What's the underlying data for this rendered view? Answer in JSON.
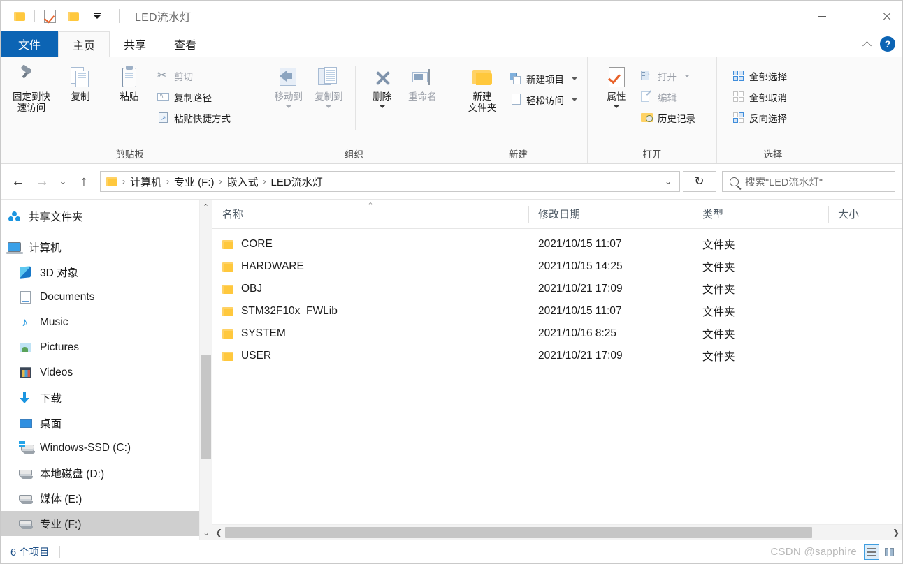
{
  "window": {
    "title": "LED流水灯",
    "quick_access": [
      "folder-icon",
      "properties-check-icon",
      "new-folder-icon",
      "customize-dropdown-icon"
    ],
    "controls": {
      "minimize": "minimize-icon",
      "maximize": "maximize-icon",
      "close": "close-icon"
    }
  },
  "ribbon": {
    "tabs": [
      {
        "label": "文件",
        "id": "file"
      },
      {
        "label": "主页",
        "id": "home"
      },
      {
        "label": "共享",
        "id": "share"
      },
      {
        "label": "查看",
        "id": "view"
      }
    ],
    "collapse_icon": "chevron-up-icon",
    "help_label": "?",
    "groups": [
      {
        "label": "剪贴板",
        "big": [
          {
            "label": "固定到快速访问",
            "line1": "固定到快",
            "line2": "速访问",
            "icon": "pin-icon"
          },
          {
            "label": "复制",
            "icon": "copy-icon"
          },
          {
            "label": "粘贴",
            "icon": "paste-icon"
          }
        ],
        "small": [
          {
            "label": "剪切",
            "icon": "scissors-icon"
          },
          {
            "label": "复制路径",
            "icon": "copy-path-icon"
          },
          {
            "label": "粘贴快捷方式",
            "icon": "paste-shortcut-icon"
          }
        ]
      },
      {
        "label": "组织",
        "big": [
          {
            "label": "移动到",
            "icon": "move-to-icon",
            "has_caret": true
          },
          {
            "label": "复制到",
            "icon": "copy-to-icon",
            "has_caret": true
          },
          {
            "label": "删除",
            "icon": "delete-icon",
            "has_caret": true
          },
          {
            "label": "重命名",
            "icon": "rename-icon"
          }
        ]
      },
      {
        "label": "新建",
        "big": [
          {
            "label": "新建文件夹",
            "line1": "新建",
            "line2": "文件夹",
            "icon": "new-folder-icon"
          }
        ],
        "small": [
          {
            "label": "新建项目",
            "icon": "new-item-icon",
            "has_caret": true
          },
          {
            "label": "轻松访问",
            "icon": "easy-access-icon",
            "has_caret": true
          }
        ]
      },
      {
        "label": "打开",
        "big": [
          {
            "label": "属性",
            "icon": "properties-icon",
            "has_caret": true
          }
        ],
        "small": [
          {
            "label": "打开",
            "icon": "open-icon",
            "has_caret": true
          },
          {
            "label": "编辑",
            "icon": "edit-icon"
          },
          {
            "label": "历史记录",
            "icon": "history-icon"
          }
        ]
      },
      {
        "label": "选择",
        "small": [
          {
            "label": "全部选择",
            "icon": "select-all-icon"
          },
          {
            "label": "全部取消",
            "icon": "select-none-icon"
          },
          {
            "label": "反向选择",
            "icon": "invert-selection-icon"
          }
        ]
      }
    ]
  },
  "address": {
    "back_icon": "back-arrow-icon",
    "forward_icon": "forward-arrow-icon",
    "recent_icon": "recent-locations-icon",
    "up_icon": "up-arrow-icon",
    "breadcrumbs": [
      "计算机",
      "专业 (F:)",
      "嵌入式",
      "LED流水灯"
    ],
    "separator": "›",
    "dropdown_icon": "chevron-down-icon",
    "refresh_icon": "refresh-icon",
    "search_placeholder": "搜索\"LED流水灯\"",
    "search_value": ""
  },
  "sidebar": {
    "items": [
      {
        "label": "共享文件夹",
        "icon": "shared-folder-icon",
        "level": 0,
        "selected": false
      },
      {
        "label": "计算机",
        "icon": "computer-icon",
        "level": 0,
        "selected": false
      },
      {
        "label": "3D 对象",
        "icon": "3d-objects-icon",
        "level": 1,
        "selected": false
      },
      {
        "label": "Documents",
        "icon": "documents-icon",
        "level": 1,
        "selected": false
      },
      {
        "label": "Music",
        "icon": "music-icon",
        "level": 1,
        "selected": false
      },
      {
        "label": "Pictures",
        "icon": "pictures-icon",
        "level": 1,
        "selected": false
      },
      {
        "label": "Videos",
        "icon": "videos-icon",
        "level": 1,
        "selected": false
      },
      {
        "label": "下载",
        "icon": "downloads-icon",
        "level": 1,
        "selected": false
      },
      {
        "label": "桌面",
        "icon": "desktop-icon",
        "level": 1,
        "selected": false
      },
      {
        "label": "Windows-SSD (C:)",
        "icon": "windows-drive-icon",
        "level": 1,
        "selected": false
      },
      {
        "label": "本地磁盘 (D:)",
        "icon": "drive-icon",
        "level": 1,
        "selected": false
      },
      {
        "label": "媒体 (E:)",
        "icon": "drive-icon",
        "level": 1,
        "selected": false
      },
      {
        "label": "专业 (F:)",
        "icon": "drive-icon",
        "level": 1,
        "selected": true
      }
    ],
    "scroll_up_icon": "chevron-up-icon",
    "scroll_down_icon": "chevron-down-icon"
  },
  "filelist": {
    "columns": [
      {
        "key": "name",
        "label": "名称",
        "sorted": true,
        "sort_icon": "sort-ascending-icon"
      },
      {
        "key": "date",
        "label": "修改日期",
        "sorted": false
      },
      {
        "key": "type",
        "label": "类型",
        "sorted": false
      },
      {
        "key": "size",
        "label": "大小",
        "sorted": false
      }
    ],
    "rows": [
      {
        "name": "CORE",
        "date": "2021/10/15 11:07",
        "type": "文件夹",
        "size": "",
        "icon": "folder-icon"
      },
      {
        "name": "HARDWARE",
        "date": "2021/10/15 14:25",
        "type": "文件夹",
        "size": "",
        "icon": "folder-icon"
      },
      {
        "name": "OBJ",
        "date": "2021/10/21 17:09",
        "type": "文件夹",
        "size": "",
        "icon": "folder-icon"
      },
      {
        "name": "STM32F10x_FWLib",
        "date": "2021/10/15 11:07",
        "type": "文件夹",
        "size": "",
        "icon": "folder-icon"
      },
      {
        "name": "SYSTEM",
        "date": "2021/10/16 8:25",
        "type": "文件夹",
        "size": "",
        "icon": "folder-icon"
      },
      {
        "name": "USER",
        "date": "2021/10/21 17:09",
        "type": "文件夹",
        "size": "",
        "icon": "folder-icon"
      }
    ],
    "hscroll_left_icon": "chevron-left-icon",
    "hscroll_right_icon": "chevron-right-icon"
  },
  "statusbar": {
    "item_count": "6 个项目",
    "watermark": "CSDN @sapphire",
    "view_buttons": [
      {
        "name": "details-view",
        "icon": "details-view-icon",
        "active": true
      },
      {
        "name": "large-icons-view",
        "icon": "large-icons-view-icon",
        "active": false
      }
    ]
  },
  "colors": {
    "accent": "#0c64b4",
    "folder": "#ffc83d",
    "selection": "#cfcfcf",
    "status_text": "#1b4e86"
  }
}
